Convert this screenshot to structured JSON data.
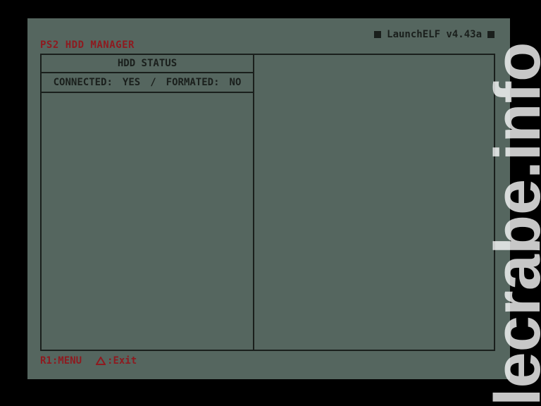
{
  "app": {
    "title": "PS2 HDD MANAGER",
    "version": "LaunchELF v4.43a"
  },
  "status_panel": {
    "header": "HDD STATUS",
    "connected_label": "CONNECTED:",
    "connected_value": "YES",
    "separator": "/",
    "formatted_label": "FORMATED:",
    "formatted_value": "NO"
  },
  "footer": {
    "menu_hint": "R1:MENU",
    "exit_icon": "triangle-icon",
    "exit_hint": ":Exit"
  },
  "watermark": {
    "text": "lecrabe.info"
  },
  "colors": {
    "background": "#000000",
    "screen": "#55665f",
    "accent_red": "#8e1a1f",
    "ink": "#1a1f1c"
  }
}
